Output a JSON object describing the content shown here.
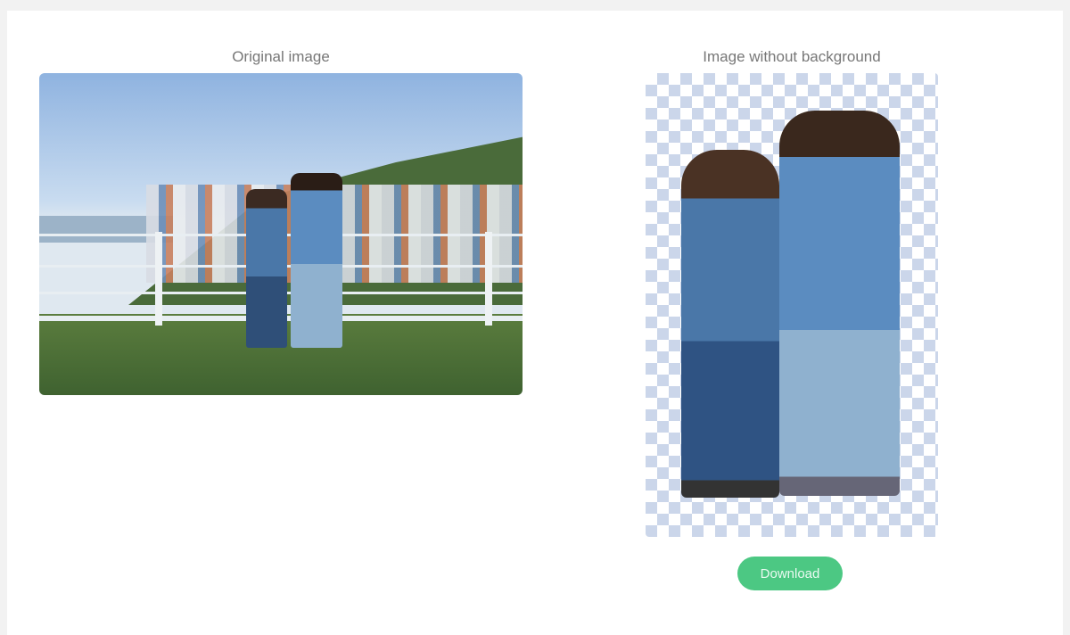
{
  "original": {
    "title": "Original image"
  },
  "result": {
    "title": "Image without background",
    "download_label": "Download"
  },
  "colors": {
    "accent": "#4cc883",
    "checker": "#cbd6ea"
  }
}
